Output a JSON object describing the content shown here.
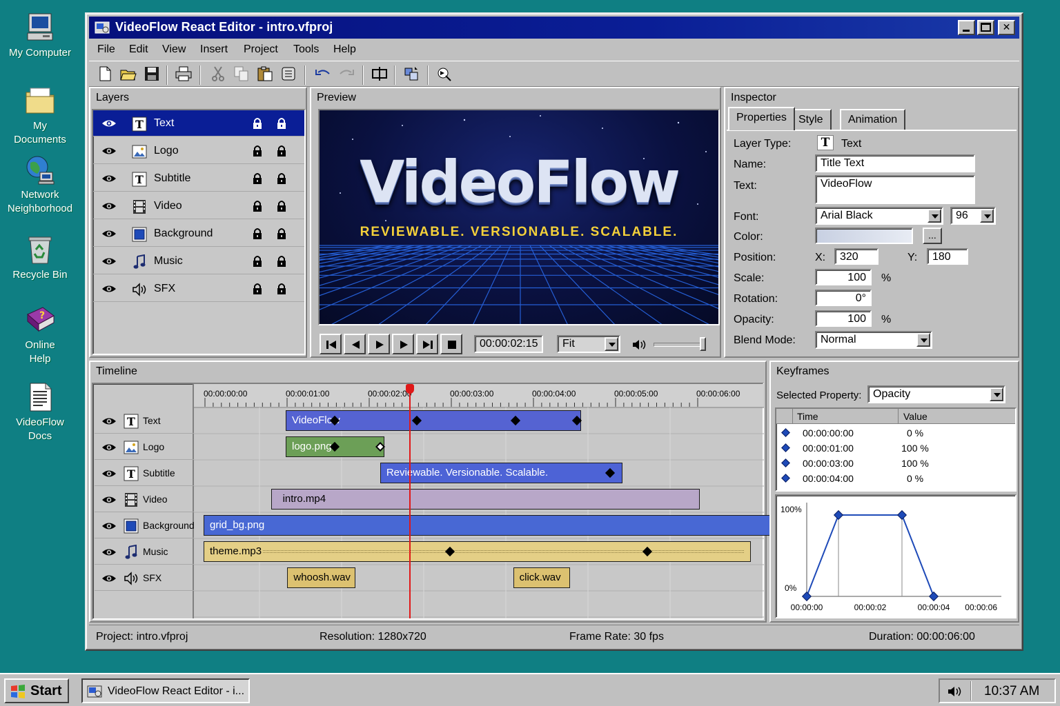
{
  "desktop": {
    "icons": [
      {
        "label": "My Computer"
      },
      {
        "label": "My Documents"
      },
      {
        "label": "Network Neighborhood"
      },
      {
        "label": "Recycle Bin"
      },
      {
        "label": "Online Help"
      },
      {
        "label": "VideoFlow Docs"
      }
    ]
  },
  "window": {
    "title": "VideoFlow React Editor - intro.vfproj",
    "buttons": {
      "minimize": "_",
      "maximize": "□",
      "close": "✕"
    }
  },
  "menu": [
    "File",
    "Edit",
    "View",
    "Insert",
    "Project",
    "Tools",
    "Help"
  ],
  "layers_panel": {
    "title": "Layers",
    "selected": "Text",
    "items": [
      {
        "name": "Text",
        "icon": "text-layer-icon"
      },
      {
        "name": "Logo",
        "icon": "image-layer-icon"
      },
      {
        "name": "Subtitle",
        "icon": "text-layer-icon"
      },
      {
        "name": "Video",
        "icon": "film-layer-icon"
      },
      {
        "name": "Background",
        "icon": "background-layer-icon"
      },
      {
        "name": "Music",
        "icon": "music-note-icon"
      },
      {
        "name": "SFX",
        "icon": "speaker-icon"
      }
    ]
  },
  "preview": {
    "title": "Preview",
    "headline": "VideoFlow",
    "tagline": "REVIEWABLE. VERSIONABLE. SCALABLE.",
    "timecode": "00:00:02:15",
    "zoom": "Fit"
  },
  "inspector": {
    "title": "Inspector",
    "tabs": [
      "Properties",
      "Style",
      "Animation"
    ],
    "labels": {
      "layer_type": "Layer Type:",
      "name": "Name:",
      "text": "Text:",
      "font": "Font:",
      "color": "Color:",
      "position": "Position:",
      "scale": "Scale:",
      "rotation": "Rotation:",
      "opacity": "Opacity:",
      "blend_mode": "Blend Mode:",
      "x": "X:",
      "y": "Y:",
      "percent": "%",
      "color_picker": "..."
    },
    "values": {
      "layer_type": "Text",
      "name": "Title Text",
      "text": "VideoFlow",
      "font": "Arial Black",
      "font_size": "96",
      "x": "320",
      "y": "180",
      "scale": "100",
      "rotation": "0°",
      "opacity": "100",
      "blend_mode": "Normal"
    }
  },
  "timeline": {
    "title": "Timeline",
    "ruler": [
      "00:00:00:00",
      "00:00:01:00",
      "00:00:02:00",
      "00:00:03:00",
      "00:00:04:00",
      "00:00:05:00",
      "00:00:06:00"
    ],
    "tracks": [
      {
        "name": "Text",
        "icon": "text-layer-icon"
      },
      {
        "name": "Logo",
        "icon": "image-layer-icon"
      },
      {
        "name": "Subtitle",
        "icon": "text-layer-icon"
      },
      {
        "name": "Video",
        "icon": "film-layer-icon"
      },
      {
        "name": "Background",
        "icon": "background-layer-icon"
      },
      {
        "name": "Music",
        "icon": "music-note-icon"
      },
      {
        "name": "SFX",
        "icon": "speaker-icon"
      }
    ],
    "clips": {
      "text": "VideoFlow",
      "logo": "logo.png",
      "subtitle": "Reviewable. Versionable. Scalable.",
      "video": "intro.mp4",
      "background": "grid_bg.png",
      "music": "theme.mp3",
      "sfx1": "whoosh.wav",
      "sfx2": "click.wav"
    },
    "colors": {
      "text_clip": "#5563d2",
      "logo_clip": "#6c9f57",
      "subtitle_clip": "#4d63d6",
      "video_clip": "#b8a7c8",
      "background_clip": "#4868d4",
      "music_clip": "#e4cf86",
      "sfx_clip": "#dcc170",
      "playhead": "#e01818"
    }
  },
  "keyframes": {
    "title": "Keyframes",
    "selected_property_label": "Selected Property:",
    "selected_property": "Opacity",
    "columns": [
      "Time",
      "Value"
    ],
    "rows": [
      {
        "time": "00:00:00:00",
        "value": "0 %"
      },
      {
        "time": "00:00:01:00",
        "value": "100 %"
      },
      {
        "time": "00:00:03:00",
        "value": "100 %"
      },
      {
        "time": "00:00:04:00",
        "value": "0 %"
      }
    ],
    "graph": {
      "y_labels": [
        "100%",
        "0%"
      ],
      "x_labels": [
        "00:00:00",
        "00:00:02",
        "00:00:04",
        "00:00:06"
      ]
    },
    "chart_data": {
      "type": "line",
      "x": [
        0,
        1,
        3,
        4
      ],
      "y": [
        0,
        100,
        100,
        0
      ],
      "xlim": [
        0,
        6
      ],
      "ylim": [
        0,
        100
      ],
      "xlabel": "",
      "ylabel": "",
      "title": ""
    }
  },
  "status": {
    "project": "Project: intro.vfproj",
    "resolution": "Resolution: 1280x720",
    "frame_rate": "Frame Rate: 30 fps",
    "duration": "Duration: 00:00:06:00"
  },
  "taskbar": {
    "start": "Start",
    "task": "VideoFlow React Editor - i...",
    "clock": "10:37 AM"
  }
}
